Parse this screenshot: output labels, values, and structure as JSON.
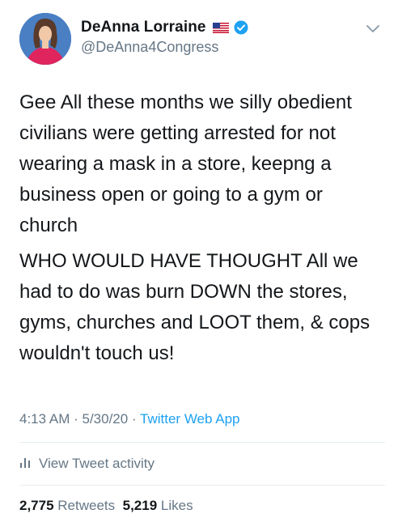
{
  "user": {
    "display_name": "DeAnna Lorraine",
    "handle": "@DeAnna4Congress"
  },
  "icons": {
    "flag": "us-flag-icon",
    "verified": "verified-badge-icon",
    "more": "chevron-down-icon",
    "activity": "bar-chart-icon"
  },
  "colors": {
    "accent": "#1da1f2",
    "secondary_text": "#657786",
    "primary_text": "#14171a"
  },
  "tweet": {
    "paragraph_1": "Gee All these months we silly obedient civilians were getting arrested for not wearing a mask in a store, keepng a business open or going to a gym or church",
    "paragraph_2": "WHO WOULD HAVE THOUGHT All we had to do was burn DOWN the stores, gyms, churches and LOOT them, & cops wouldn't touch us!"
  },
  "meta": {
    "time": "4:13 AM",
    "separator": " · ",
    "date": "5/30/20",
    "source": "Twitter Web App"
  },
  "activity": {
    "label": "View Tweet activity"
  },
  "stats": {
    "retweets_count": "2,775",
    "retweets_label": "Retweets",
    "likes_count": "5,219",
    "likes_label": "Likes"
  }
}
